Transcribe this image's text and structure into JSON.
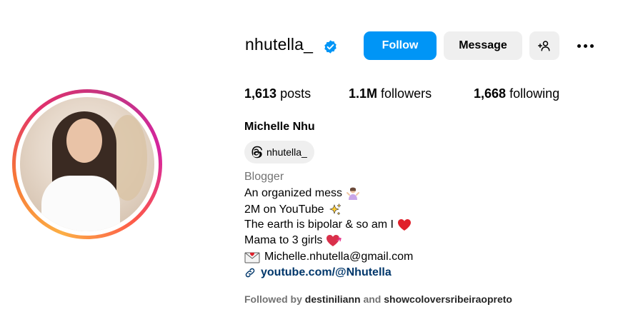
{
  "profile": {
    "username": "nhutella_",
    "follow_label": "Follow",
    "message_label": "Message",
    "stats": {
      "posts_count": "1,613",
      "posts_label": "posts",
      "followers_count": "1.1M",
      "followers_label": "followers",
      "following_count": "1,668",
      "following_label": "following"
    },
    "full_name": "Michelle Nhu",
    "threads_handle": "nhutella_",
    "category": "Blogger",
    "bio": [
      "An organized mess",
      "2M on YouTube",
      "The earth is bipolar & so am I",
      "Mama to 3 girls",
      "Michelle.nhutella@gmail.com"
    ],
    "link": "youtube.com/@Nhutella",
    "followed_by_prefix": "Followed by",
    "followed_by_user1": "destiniliann",
    "followed_by_and": "and",
    "followed_by_user2": "showcoloversribeiraopreto"
  },
  "colors": {
    "accent": "#0095f6",
    "secondary_button": "#efefef",
    "muted_text": "#737373",
    "link": "#00376b"
  },
  "icons": [
    "verified-badge-icon",
    "add-user-icon",
    "more-options-icon",
    "threads-icon",
    "link-icon",
    "envelope-icon",
    "sparkles-icon",
    "heart-icon",
    "person-shrug-icon"
  ]
}
